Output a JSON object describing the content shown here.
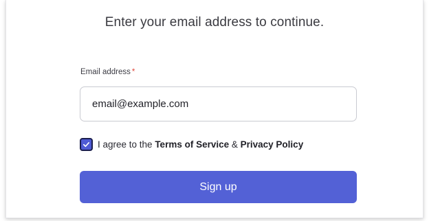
{
  "form": {
    "heading": "Enter your email address to continue.",
    "email": {
      "label": "Email address",
      "required_mark": "*",
      "value": "email@example.com"
    },
    "agree": {
      "checked": true,
      "prefix": "I agree to the ",
      "terms_link": "Terms of Service",
      "separator": " & ",
      "privacy_link": "Privacy Policy"
    },
    "submit_label": "Sign up"
  },
  "colors": {
    "primary": "#5361d6",
    "checkbox": "#4f5bd5",
    "required": "#e0473a",
    "text": "#3a3a40"
  },
  "icons": {
    "checkbox": "checkmark-icon"
  }
}
